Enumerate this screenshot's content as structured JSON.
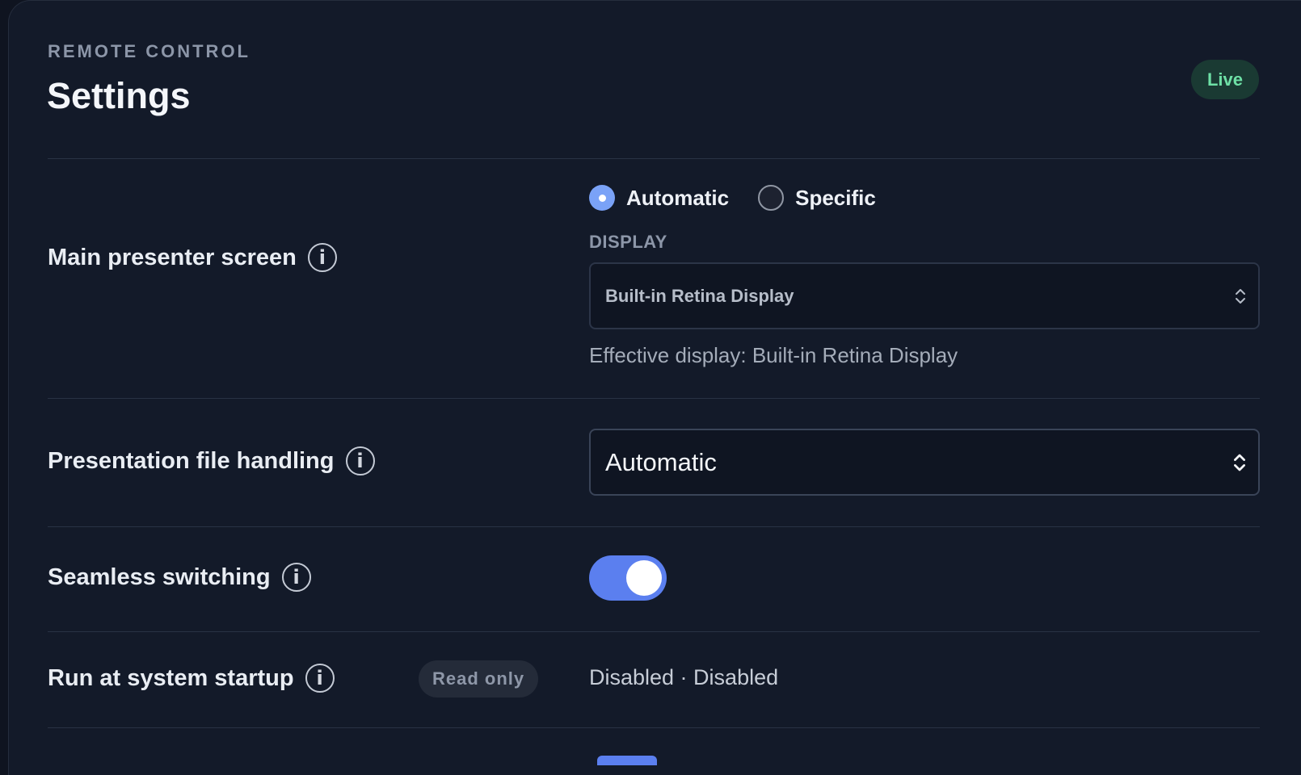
{
  "header": {
    "eyebrow": "REMOTE CONTROL",
    "title": "Settings",
    "status_badge": "Live"
  },
  "rows": {
    "main_presenter_screen": {
      "label": "Main presenter screen",
      "info_icon": "info-icon",
      "options": [
        {
          "label": "Automatic",
          "selected": true
        },
        {
          "label": "Specific",
          "selected": false
        }
      ],
      "field_label": "DISPLAY",
      "display_value": "Built-in Retina Display",
      "hint": "Effective display: Built-in Retina Display"
    },
    "presentation_file_handling": {
      "label": "Presentation file handling",
      "info_icon": "info-icon",
      "value": "Automatic"
    },
    "seamless_switching": {
      "label": "Seamless switching",
      "info_icon": "info-icon",
      "enabled": true
    },
    "run_at_startup": {
      "label": "Run at system startup",
      "info_icon": "info-icon",
      "badge": "Read only",
      "value": "Disabled · Disabled"
    }
  },
  "colors": {
    "background": "#131a29",
    "accent": "#5b7fef",
    "radio_accent": "#7aa2f7",
    "live_text": "#6ee0a6",
    "live_bg": "#1a3a33"
  }
}
